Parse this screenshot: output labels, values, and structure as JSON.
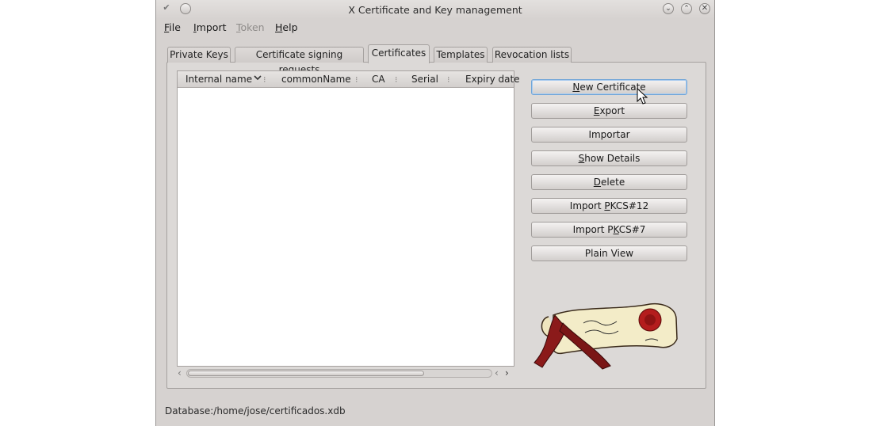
{
  "window": {
    "title": "X Certificate and Key management"
  },
  "menubar": {
    "file": {
      "pre": "",
      "ul": "F",
      "post": "ile"
    },
    "import": {
      "pre": "",
      "ul": "I",
      "post": "mport"
    },
    "token": {
      "pre": "",
      "ul": "T",
      "post": "oken"
    },
    "help": {
      "pre": "",
      "ul": "H",
      "post": "elp"
    }
  },
  "tabs": [
    {
      "label": "Private Keys"
    },
    {
      "label": "Certificate signing requests"
    },
    {
      "label": "Certificates"
    },
    {
      "label": "Templates"
    },
    {
      "label": "Revocation lists"
    }
  ],
  "list": {
    "columns": [
      "Internal name",
      "commonName",
      "CA",
      "Serial",
      "Expiry date"
    ],
    "rows": []
  },
  "buttons": {
    "new_certificate": {
      "pre": "",
      "ul": "N",
      "post": "ew Certificate"
    },
    "export": {
      "pre": "",
      "ul": "E",
      "post": "xport"
    },
    "importar": {
      "pre": "Importar",
      "ul": "",
      "post": ""
    },
    "show_details": {
      "pre": "",
      "ul": "S",
      "post": "how Details"
    },
    "delete": {
      "pre": "",
      "ul": "D",
      "post": "elete"
    },
    "import_pkcs12": {
      "pre": "Import ",
      "ul": "P",
      "post": "KCS#12"
    },
    "import_pkcs7": {
      "pre": "Import P",
      "ul": "K",
      "post": "CS#7"
    },
    "plain_view": {
      "pre": "Plain View",
      "ul": "",
      "post": ""
    }
  },
  "status": {
    "text": "Database:/home/jose/certificados.xdb"
  },
  "colors": {
    "window_bg": "#d6d2d0",
    "focus_border": "#6fa5d8",
    "logo_red": "#8b1a1a",
    "logo_parchment": "#f3ecc8"
  },
  "icons": {
    "logo": "scroll-with-wax-seal",
    "sort": "chevron-down-icon",
    "column_separator": "grip-dots-icon"
  }
}
